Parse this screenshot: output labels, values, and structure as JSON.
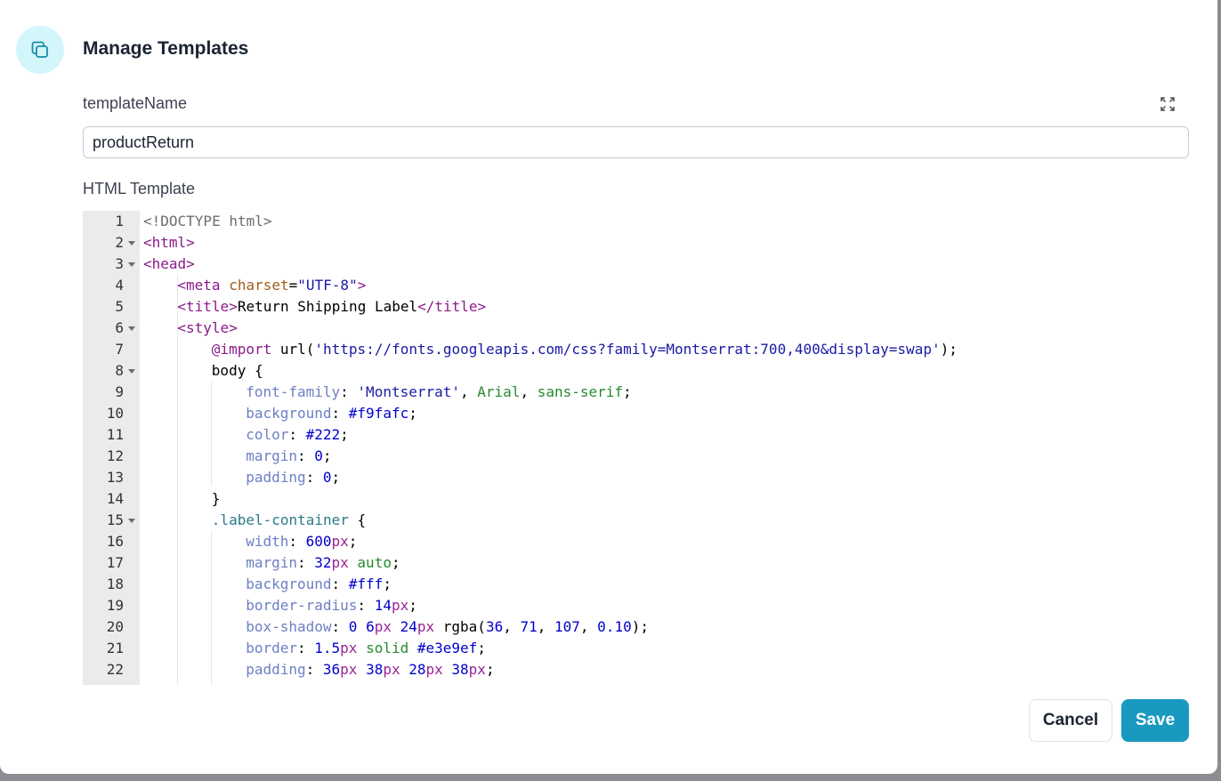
{
  "dialog": {
    "title": "Manage Templates",
    "template_name_label": "templateName",
    "template_name_value": "productReturn",
    "html_template_label": "HTML Template",
    "cancel_label": "Cancel",
    "save_label": "Save",
    "accent_color": "#1a99c0",
    "icon": "copy-icon",
    "expand_icon": "expand-icon"
  },
  "editor": {
    "lines": [
      {
        "n": "1",
        "fold": false,
        "indent": 0,
        "tokens": [
          [
            "doctype",
            "<!DOCTYPE html>"
          ]
        ]
      },
      {
        "n": "2",
        "fold": true,
        "indent": 0,
        "tokens": [
          [
            "tag",
            "<html>"
          ]
        ]
      },
      {
        "n": "3",
        "fold": true,
        "indent": 0,
        "tokens": [
          [
            "tag",
            "<head>"
          ]
        ]
      },
      {
        "n": "4",
        "fold": false,
        "indent": 1,
        "tokens": [
          [
            "tag",
            "<meta "
          ],
          [
            "attr",
            "charset"
          ],
          [
            "plain",
            "="
          ],
          [
            "str",
            "\"UTF-8\""
          ],
          [
            "tag",
            ">"
          ]
        ]
      },
      {
        "n": "5",
        "fold": false,
        "indent": 1,
        "tokens": [
          [
            "tag",
            "<title>"
          ],
          [
            "plain",
            "Return Shipping Label"
          ],
          [
            "tag",
            "</title>"
          ]
        ]
      },
      {
        "n": "6",
        "fold": true,
        "indent": 1,
        "tokens": [
          [
            "tag",
            "<style>"
          ]
        ]
      },
      {
        "n": "7",
        "fold": false,
        "indent": 2,
        "tokens": [
          [
            "at",
            "@import "
          ],
          [
            "plain",
            "url("
          ],
          [
            "str",
            "'https://fonts.googleapis.com/css?family=Montserrat:700,400&display=swap'"
          ],
          [
            "plain",
            ");"
          ]
        ]
      },
      {
        "n": "8",
        "fold": true,
        "indent": 2,
        "tokens": [
          [
            "plain",
            "body {"
          ]
        ]
      },
      {
        "n": "9",
        "fold": false,
        "indent": 3,
        "tokens": [
          [
            "prop",
            "font-family"
          ],
          [
            "plain",
            ": "
          ],
          [
            "str",
            "'Montserrat'"
          ],
          [
            "plain",
            ", "
          ],
          [
            "kw",
            "Arial"
          ],
          [
            "plain",
            ", "
          ],
          [
            "kw",
            "sans-serif"
          ],
          [
            "plain",
            ";"
          ]
        ]
      },
      {
        "n": "10",
        "fold": false,
        "indent": 3,
        "tokens": [
          [
            "prop",
            "background"
          ],
          [
            "plain",
            ": "
          ],
          [
            "num",
            "#f9fafc"
          ],
          [
            "plain",
            ";"
          ]
        ]
      },
      {
        "n": "11",
        "fold": false,
        "indent": 3,
        "tokens": [
          [
            "prop",
            "color"
          ],
          [
            "plain",
            ": "
          ],
          [
            "num",
            "#222"
          ],
          [
            "plain",
            ";"
          ]
        ]
      },
      {
        "n": "12",
        "fold": false,
        "indent": 3,
        "tokens": [
          [
            "prop",
            "margin"
          ],
          [
            "plain",
            ": "
          ],
          [
            "num",
            "0"
          ],
          [
            "plain",
            ";"
          ]
        ]
      },
      {
        "n": "13",
        "fold": false,
        "indent": 3,
        "tokens": [
          [
            "prop",
            "padding"
          ],
          [
            "plain",
            ": "
          ],
          [
            "num",
            "0"
          ],
          [
            "plain",
            ";"
          ]
        ]
      },
      {
        "n": "14",
        "fold": false,
        "indent": 2,
        "tokens": [
          [
            "plain",
            "}"
          ]
        ]
      },
      {
        "n": "15",
        "fold": true,
        "indent": 2,
        "tokens": [
          [
            "sel",
            ".label-container"
          ],
          [
            "plain",
            " {"
          ]
        ]
      },
      {
        "n": "16",
        "fold": false,
        "indent": 3,
        "tokens": [
          [
            "prop",
            "width"
          ],
          [
            "plain",
            ": "
          ],
          [
            "num",
            "600"
          ],
          [
            "unit",
            "px"
          ],
          [
            "plain",
            ";"
          ]
        ]
      },
      {
        "n": "17",
        "fold": false,
        "indent": 3,
        "tokens": [
          [
            "prop",
            "margin"
          ],
          [
            "plain",
            ": "
          ],
          [
            "num",
            "32"
          ],
          [
            "unit",
            "px"
          ],
          [
            "plain",
            " "
          ],
          [
            "kw",
            "auto"
          ],
          [
            "plain",
            ";"
          ]
        ]
      },
      {
        "n": "18",
        "fold": false,
        "indent": 3,
        "tokens": [
          [
            "prop",
            "background"
          ],
          [
            "plain",
            ": "
          ],
          [
            "num",
            "#fff"
          ],
          [
            "plain",
            ";"
          ]
        ]
      },
      {
        "n": "19",
        "fold": false,
        "indent": 3,
        "tokens": [
          [
            "prop",
            "border-radius"
          ],
          [
            "plain",
            ": "
          ],
          [
            "num",
            "14"
          ],
          [
            "unit",
            "px"
          ],
          [
            "plain",
            ";"
          ]
        ]
      },
      {
        "n": "20",
        "fold": false,
        "indent": 3,
        "tokens": [
          [
            "prop",
            "box-shadow"
          ],
          [
            "plain",
            ": "
          ],
          [
            "num",
            "0"
          ],
          [
            "plain",
            " "
          ],
          [
            "num",
            "6"
          ],
          [
            "unit",
            "px"
          ],
          [
            "plain",
            " "
          ],
          [
            "num",
            "24"
          ],
          [
            "unit",
            "px"
          ],
          [
            "plain",
            " rgba("
          ],
          [
            "num",
            "36"
          ],
          [
            "plain",
            ", "
          ],
          [
            "num",
            "71"
          ],
          [
            "plain",
            ", "
          ],
          [
            "num",
            "107"
          ],
          [
            "plain",
            ", "
          ],
          [
            "num",
            "0.10"
          ],
          [
            "plain",
            ");"
          ]
        ]
      },
      {
        "n": "21",
        "fold": false,
        "indent": 3,
        "tokens": [
          [
            "prop",
            "border"
          ],
          [
            "plain",
            ": "
          ],
          [
            "num",
            "1.5"
          ],
          [
            "unit",
            "px"
          ],
          [
            "plain",
            " "
          ],
          [
            "kw",
            "solid"
          ],
          [
            "plain",
            " "
          ],
          [
            "num",
            "#e3e9ef"
          ],
          [
            "plain",
            ";"
          ]
        ]
      },
      {
        "n": "22",
        "fold": false,
        "indent": 3,
        "tokens": [
          [
            "prop",
            "padding"
          ],
          [
            "plain",
            ": "
          ],
          [
            "num",
            "36"
          ],
          [
            "unit",
            "px"
          ],
          [
            "plain",
            " "
          ],
          [
            "num",
            "38"
          ],
          [
            "unit",
            "px"
          ],
          [
            "plain",
            " "
          ],
          [
            "num",
            "28"
          ],
          [
            "unit",
            "px"
          ],
          [
            "plain",
            " "
          ],
          [
            "num",
            "38"
          ],
          [
            "unit",
            "px"
          ],
          [
            "plain",
            ";"
          ]
        ]
      }
    ]
  }
}
